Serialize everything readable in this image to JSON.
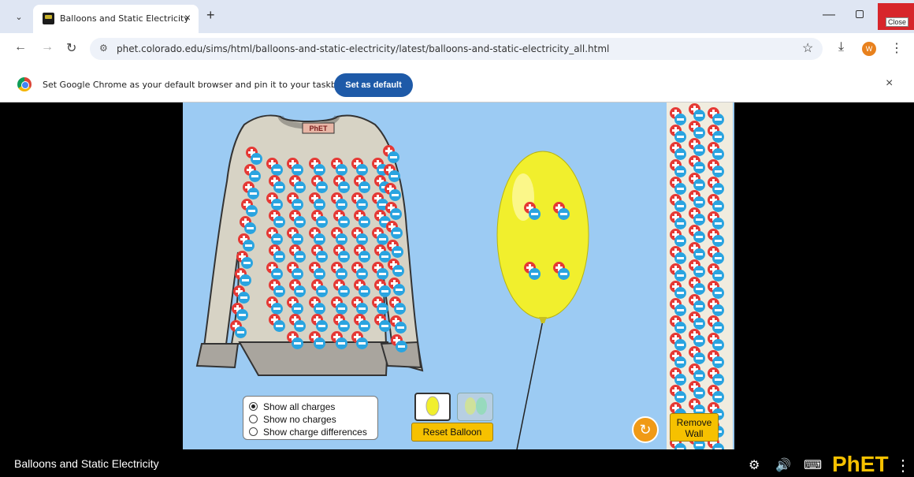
{
  "browser": {
    "tab_title": "Balloons and Static Electricity",
    "url": "phet.colorado.edu/sims/html/balloons-and-static-electricity/latest/balloons-and-static-electricity_all.html",
    "close_tooltip": "Close",
    "profile_initial": "W"
  },
  "infobar": {
    "message": "Set Google Chrome as your default browser and pin it to your taskbar",
    "button": "Set as default"
  },
  "sim": {
    "sweater_label": "PhET",
    "radio_options": [
      "Show all charges",
      "Show no charges",
      "Show charge differences"
    ],
    "selected_radio": 0,
    "reset_balloon": "Reset Balloon",
    "remove_wall": "Remove Wall",
    "reset_all_icon": "reset-icon",
    "balloon_color": "#f1ef2d",
    "background": "#9ccbf3"
  },
  "footer": {
    "title": "Balloons and Static Electricity",
    "logo_text": "PhET"
  }
}
